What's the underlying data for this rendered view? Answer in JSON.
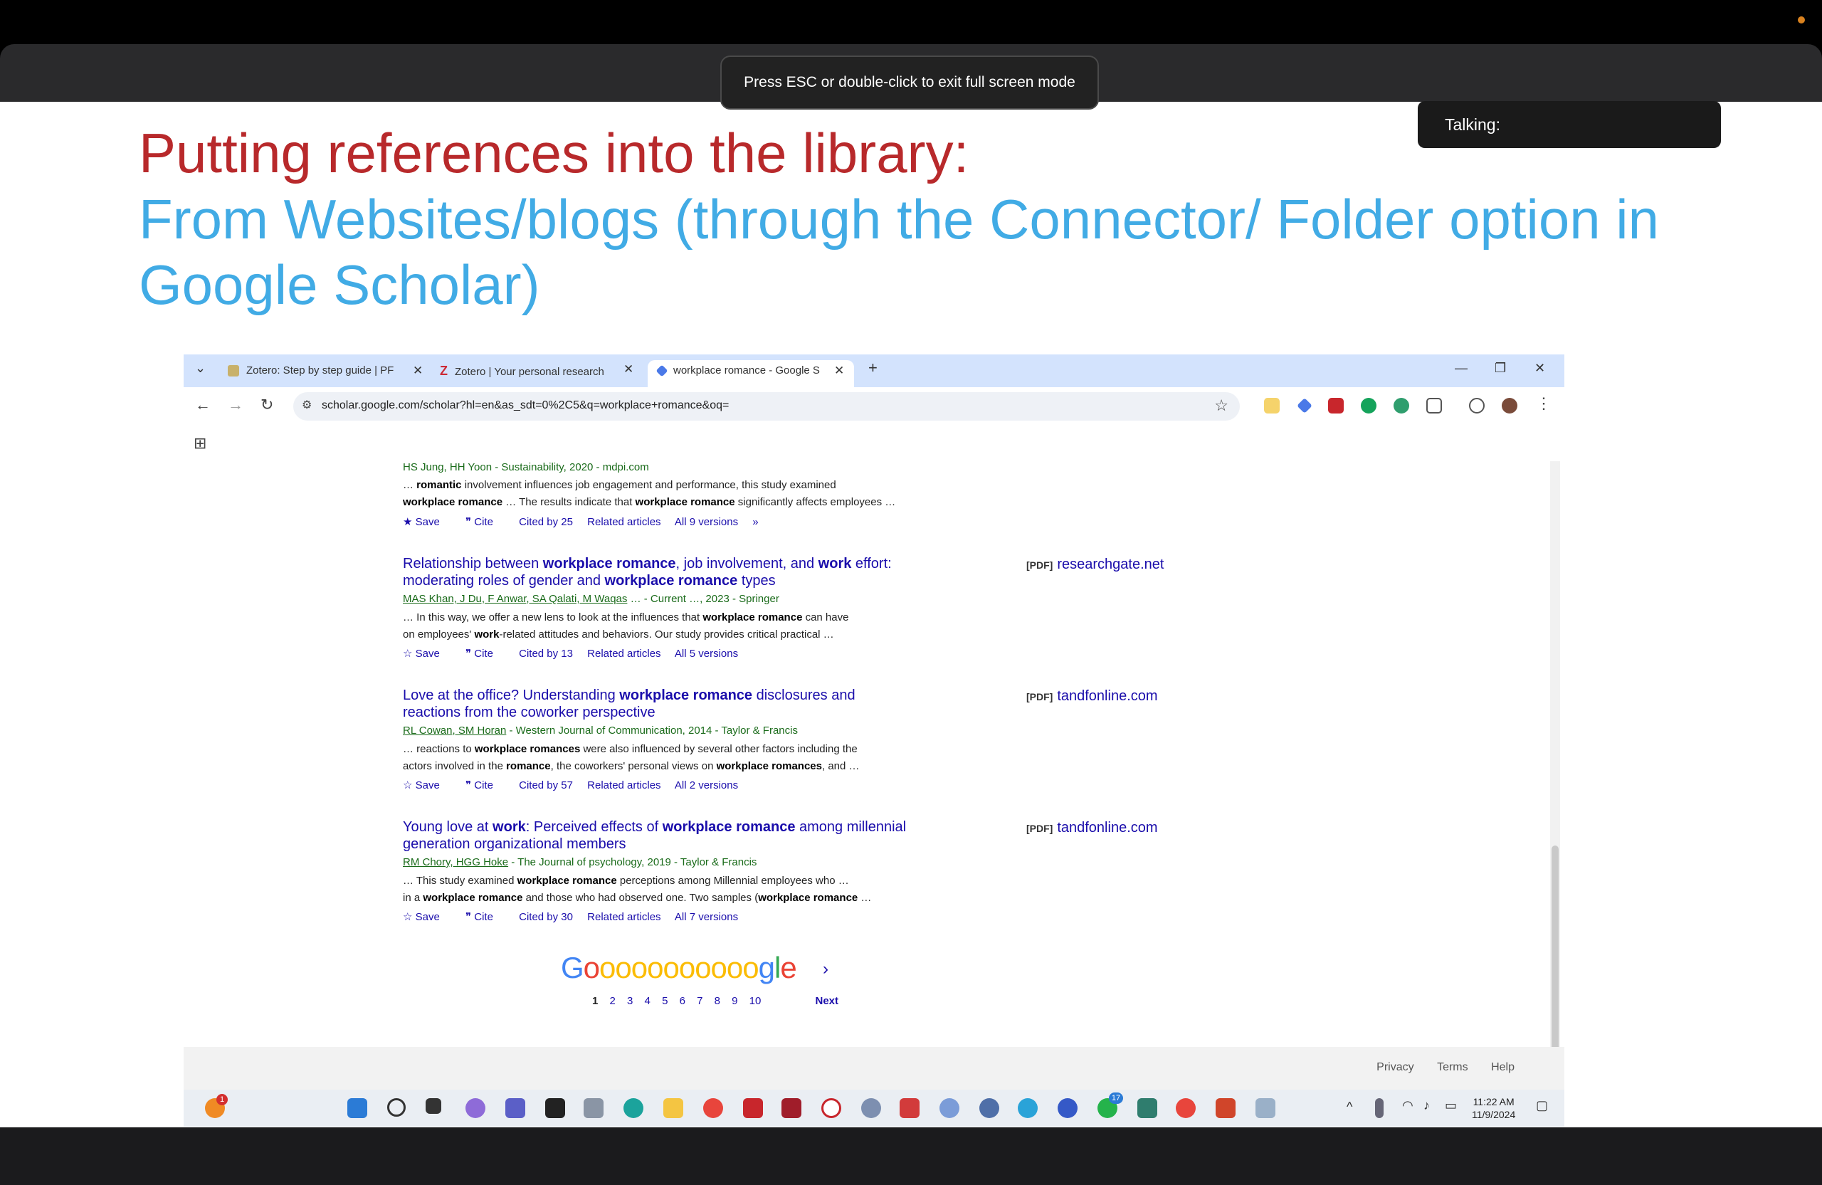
{
  "fullscreen_toast": "Press ESC or double-click to exit full screen mode",
  "talking_label": "Talking:",
  "slide": {
    "title_line1": "Putting references into the library:",
    "title_line2": "From Websites/blogs (through the Connector/ Folder option in Google Scholar)"
  },
  "browser": {
    "tabs": [
      {
        "label": "Zotero: Step by step guide | PF"
      },
      {
        "label": "Zotero | Your personal research"
      },
      {
        "label": "workplace romance - Google S"
      }
    ],
    "url": "scholar.google.com/scholar?hl=en&as_sdt=0%2C5&q=workplace+romance&oq="
  },
  "scholar": {
    "result0": {
      "meta": "HS Jung, HH Yoon - Sustainability, 2020 - mdpi.com",
      "snippet1_pre": "… ",
      "snippet1_bold": "romantic",
      "snippet1_post": " involvement influences job engagement and performance, this study examined",
      "snippet2_b1": "workplace romance",
      "snippet2_mid": " … The results indicate that ",
      "snippet2_b2": "workplace romance",
      "snippet2_post": " significantly affects employees …",
      "save": "Save",
      "cite": "Cite",
      "cited_by": "Cited by 25",
      "related": "Related articles",
      "versions": "All 9 versions"
    },
    "result1": {
      "title_a": "Relationship between ",
      "title_b": "workplace romance",
      "title_c": ", job involvement, and ",
      "title_d": "work",
      "title_e": " effort:",
      "title_f": "moderating roles of gender and ",
      "title_g": "workplace romance",
      "title_h": " types",
      "meta_authors": "MAS Khan, J Du, F Anwar, SA Qalati, M Waqas",
      "meta_rest": "… - Current …, 2023 - Springer",
      "snip1": "… In this way, we offer a new lens to look at the influences that ",
      "snip1b": "workplace romance",
      "snip1c": " can have",
      "snip2": "on employees' ",
      "snip2b": "work",
      "snip2c": "-related attitudes and behaviors. Our study provides critical practical …",
      "pdf_tag": "[PDF]",
      "pdf_site": "researchgate.net",
      "save": "Save",
      "cite": "Cite",
      "cited_by": "Cited by 13",
      "related": "Related articles",
      "versions": "All 5 versions"
    },
    "result2": {
      "title_a": "Love at the office? Understanding ",
      "title_b": "workplace romance",
      "title_c": " disclosures and",
      "title_d": "reactions from the coworker perspective",
      "meta_authors": "RL Cowan, SM Horan",
      "meta_rest": " - Western Journal of Communication, 2014 - Taylor & Francis",
      "snip1": "… reactions to ",
      "snip1b": "workplace romances",
      "snip1c": " were also influenced by several other factors including the",
      "snip2": "actors involved in the ",
      "snip2b": "romance",
      "snip2c": ", the coworkers' personal views on ",
      "snip2d": "workplace romances",
      "snip2e": ", and …",
      "pdf_tag": "[PDF]",
      "pdf_site": "tandfonline.com",
      "save": "Save",
      "cite": "Cite",
      "cited_by": "Cited by 57",
      "related": "Related articles",
      "versions": "All 2 versions"
    },
    "result3": {
      "title_a": "Young love at ",
      "title_b": "work",
      "title_c": ": Perceived effects of ",
      "title_d": "workplace romance",
      "title_e": " among millennial",
      "title_f": "generation organizational members",
      "meta_authors": "RM Chory, HGG Hoke",
      "meta_rest": " - The Journal of psychology, 2019 - Taylor & Francis",
      "snip1": "… This study examined ",
      "snip1b": "workplace romance",
      "snip1c": " perceptions among Millennial employees who …",
      "snip2": "in a ",
      "snip2b": "workplace romance",
      "snip2c": " and those who had observed one. Two samples (",
      "snip2d": "workplace romance",
      "snip2e": " …",
      "pdf_tag": "[PDF]",
      "pdf_site": "tandfonline.com",
      "save": "Save",
      "cite": "Cite",
      "cited_by": "Cited by 30",
      "related": "Related articles",
      "versions": "All 7 versions"
    },
    "pagination": {
      "logo": "Gooooooooooogle",
      "pages": [
        "1",
        "2",
        "3",
        "4",
        "5",
        "6",
        "7",
        "8",
        "9",
        "10"
      ],
      "next": "Next"
    },
    "footer": {
      "privacy": "Privacy",
      "terms": "Terms",
      "help": "Help"
    }
  },
  "taskbar": {
    "time": "11:22 AM",
    "date": "11/9/2024",
    "badge_left": "1",
    "badge_whatsapp": "17"
  },
  "colors": {
    "title_red": "#b8292b",
    "title_blue": "#41abe5",
    "link_blue": "#1a0dab",
    "meta_green": "#1a6b1a"
  }
}
